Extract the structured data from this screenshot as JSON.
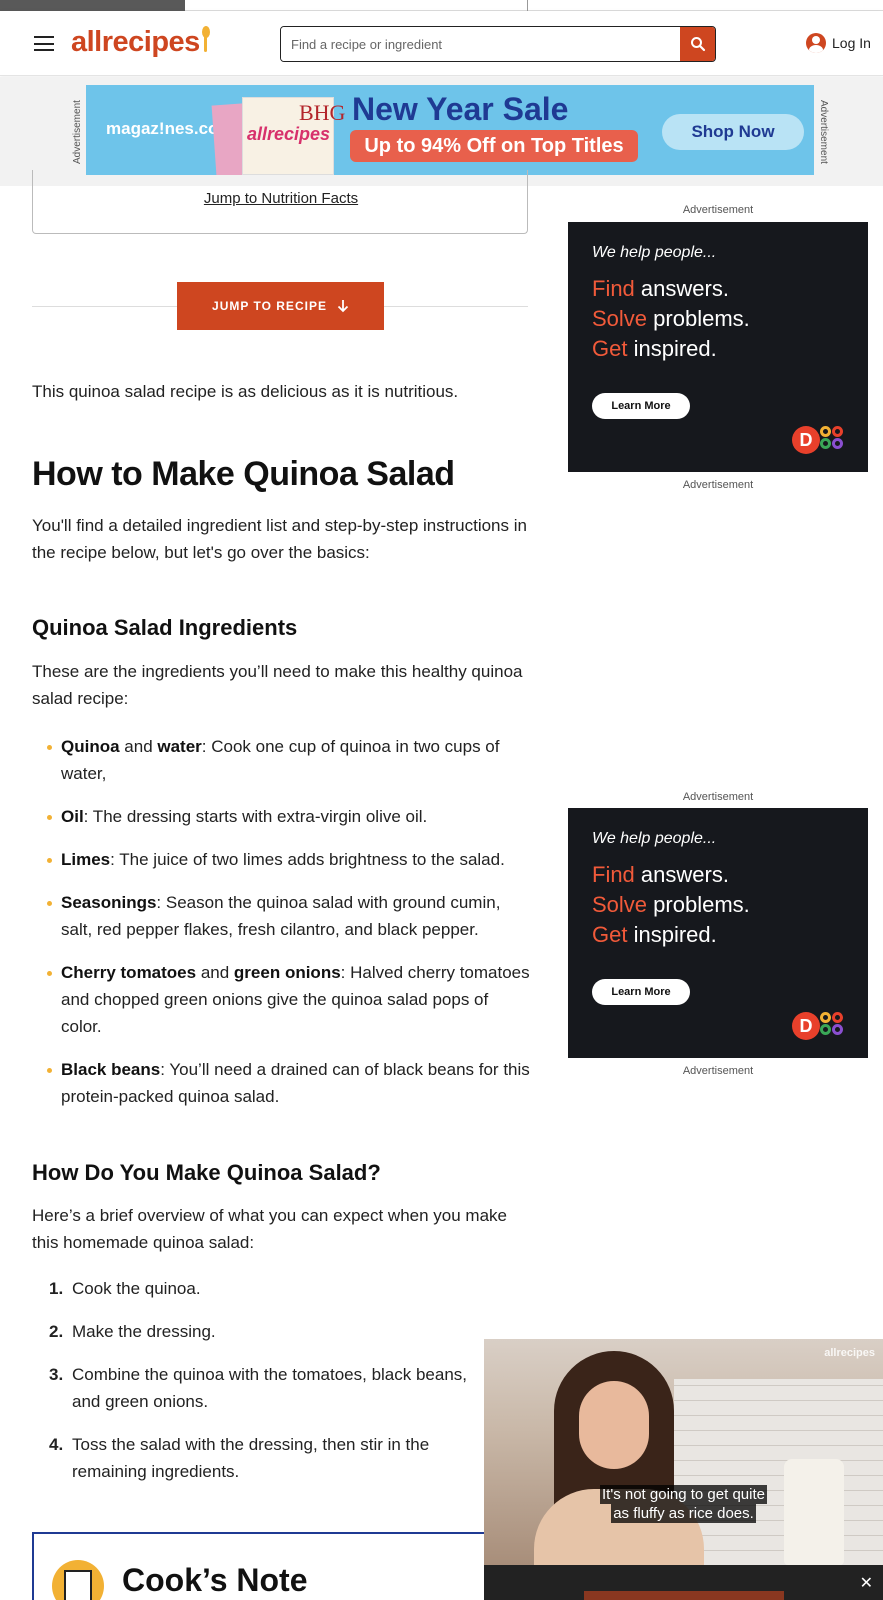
{
  "header": {
    "logo_text": "allrecipes",
    "search_placeholder": "Find a recipe or ingredient",
    "login_label": "Log In"
  },
  "ad_banner": {
    "side_label": "Advertisement",
    "brand": "magaz!nes.com",
    "headline": "New Year Sale",
    "offer": "Up to 94% Off on Top Titles",
    "cta": "Shop Now",
    "cover_title_1": "allrecipes",
    "cover_title_2": "BHG"
  },
  "nutrition_link": "Jump to Nutrition Facts",
  "jump_button": "JUMP TO RECIPE",
  "intro": "This quinoa salad recipe is as delicious as it is nutritious.",
  "section1": {
    "title": "How to Make Quinoa Salad",
    "text": "You'll find a detailed ingredient list and step-by-step instructions in the recipe below, but let's go over the basics:"
  },
  "ingredients": {
    "title": "Quinoa Salad Ingredients",
    "intro": "These are the ingredients you’ll need to make this healthy quinoa salad recipe:",
    "items": [
      {
        "b1": "Quinoa",
        "mid": " and ",
        "b2": "water",
        "text": ": Cook one cup of quinoa in two cups of water,"
      },
      {
        "b1": "Oil",
        "mid": "",
        "b2": "",
        "text": ": The dressing starts with extra-virgin olive oil."
      },
      {
        "b1": "Limes",
        "mid": "",
        "b2": "",
        "text": ": The juice of two limes adds brightness to the salad."
      },
      {
        "b1": "Seasonings",
        "mid": "",
        "b2": "",
        "text": ": Season the quinoa salad with ground cumin, salt, red pepper flakes, fresh cilantro, and black pepper."
      },
      {
        "b1": "Cherry tomatoes",
        "mid": " and ",
        "b2": "green onions",
        "text": ": Halved cherry tomatoes and chopped green onions give the quinoa salad pops of color."
      },
      {
        "b1": "Black beans",
        "mid": "",
        "b2": "",
        "text": ": You’ll need a drained can of black beans for this protein-packed quinoa salad."
      }
    ]
  },
  "howto": {
    "title": "How Do You Make Quinoa Salad?",
    "intro": "Here’s a brief overview of what you can expect when you make this homemade quinoa salad:",
    "steps": [
      {
        "num": "1.",
        "text": "Cook the quinoa."
      },
      {
        "num": "2.",
        "text": "Make the dressing."
      },
      {
        "num": "3.",
        "text": "Combine the quinoa with the tomatoes, black beans, and green onions."
      },
      {
        "num": "4.",
        "text": "Toss the salad with the dressing, then stir in the remaining ingredients."
      }
    ]
  },
  "cooks_note": {
    "title": "Cook’s Note"
  },
  "rail_ads": {
    "label": "Advertisement",
    "tagline": "We help people...",
    "line1_o": "Find",
    "line1": " answers.",
    "line2_o": "Solve",
    "line2": " problems.",
    "line3_o": "Get",
    "line3": " inspired.",
    "cta": "Learn More",
    "logo_letter": "D"
  },
  "video": {
    "watermark": "allrecipes",
    "caption_line1": "It's not going to get quite",
    "caption_line2": "as fluffy as rice does.",
    "close_glyph": "✕"
  },
  "colors": {
    "brand_orange": "#ce4620",
    "bullet_gold": "#f2b134",
    "ad_dark": "#16181d",
    "ad_accent": "#f15a3a"
  }
}
